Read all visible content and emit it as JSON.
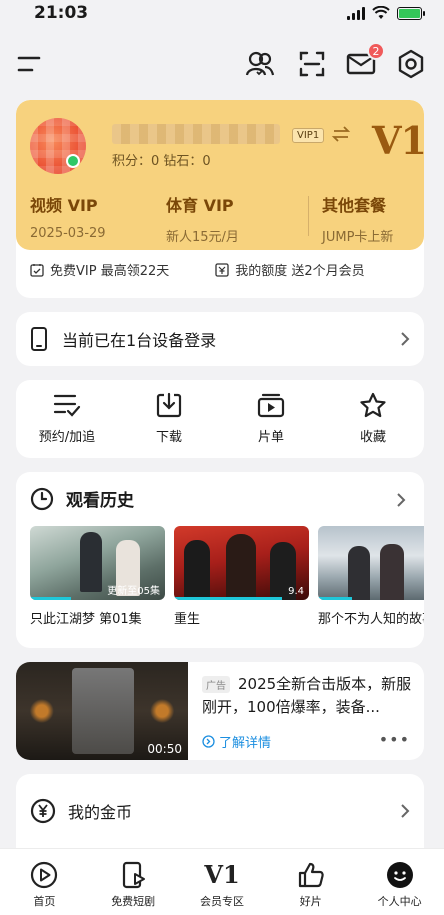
{
  "status_bar": {
    "time": "21:03"
  },
  "header": {
    "notification_count": "2"
  },
  "vip_card": {
    "level_tag": "VIP1",
    "big_level": "V1",
    "points": "积分：0  钻石：0",
    "columns": [
      {
        "title": "视频 VIP",
        "subtitle": "2025-03-29"
      },
      {
        "title": "体育 VIP",
        "subtitle": "新人15元/月"
      },
      {
        "title": "其他套餐",
        "subtitle": "JUMP卡上新"
      }
    ],
    "bottom_left": "免费VIP 最高领22天",
    "bottom_right": "我的额度 送2个月会员"
  },
  "device": {
    "label": "当前已在1台设备登录"
  },
  "quick_actions": [
    {
      "label": "预约/加追",
      "icon": "reserve-icon"
    },
    {
      "label": "下载",
      "icon": "download-icon"
    },
    {
      "label": "片单",
      "icon": "playlist-icon"
    },
    {
      "label": "收藏",
      "icon": "star-icon"
    }
  ],
  "history": {
    "title": "观看历史",
    "items": [
      {
        "caption": "只此江湖梦 第01集",
        "overlay": "更新至05集",
        "progress": 0.3
      },
      {
        "caption": "重生",
        "overlay": "9.4",
        "progress": 0.8
      },
      {
        "caption": "那个不为人知的故事",
        "overlay": "",
        "progress": 0.25
      }
    ]
  },
  "ad": {
    "tag": "广告",
    "text": "2025全新合击版本，新服刚开，100倍爆率，装备...",
    "link": "了解详情",
    "duration": "00:50"
  },
  "coins": {
    "label": "我的金币"
  },
  "tabs": [
    {
      "label": "首页",
      "icon": "home-play-icon"
    },
    {
      "label": "免费短剧",
      "icon": "short-drama-icon"
    },
    {
      "label": "会员专区",
      "icon": "vip-v1-icon",
      "glyph": "V1"
    },
    {
      "label": "好片",
      "icon": "thumbs-up-icon"
    },
    {
      "label": "个人中心",
      "icon": "profile-face-icon"
    }
  ]
}
